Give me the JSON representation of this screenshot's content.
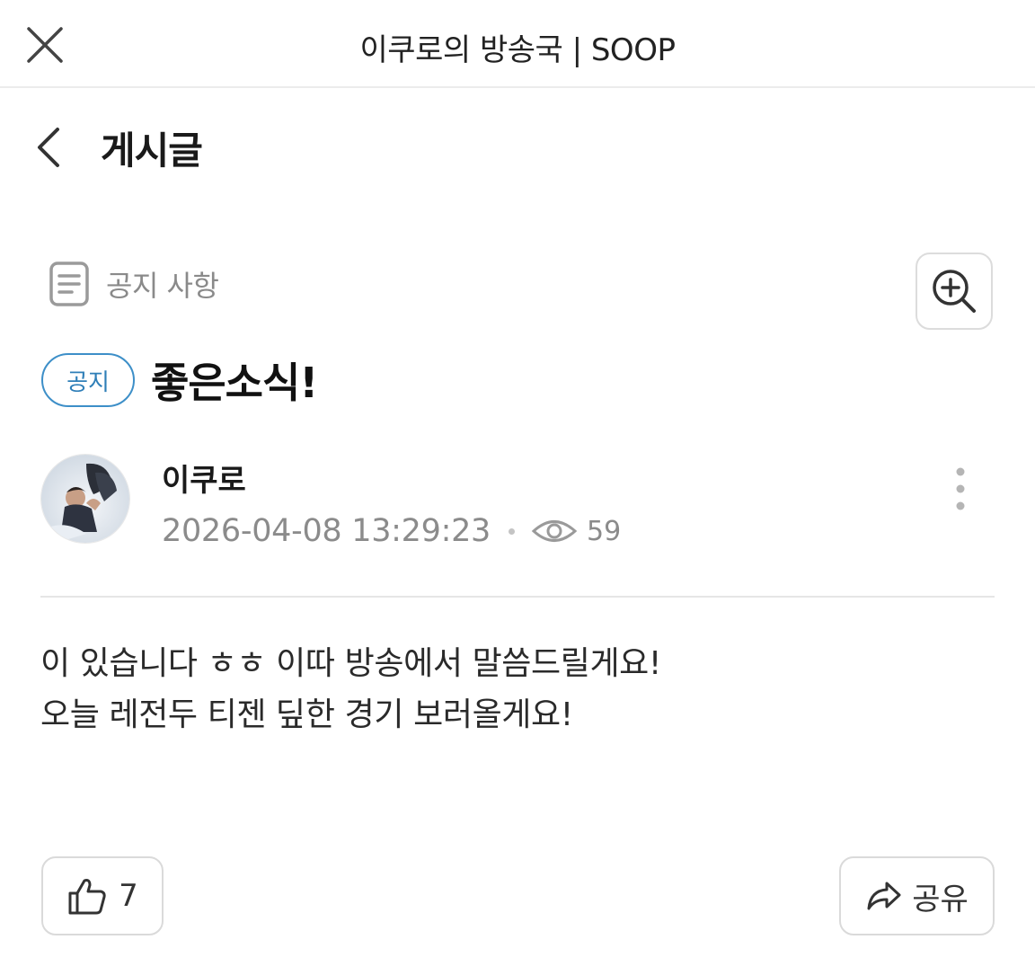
{
  "window": {
    "title": "이쿠로의 방송국 | SOOP"
  },
  "header": {
    "title": "게시글"
  },
  "post": {
    "category": "공지 사항",
    "badge": "공지",
    "title": "좋은소식!",
    "author": "이쿠로",
    "datetime": "2026-04-08 13:29:23",
    "views": "59",
    "body_lines": [
      "이 있습니다 ㅎㅎ 이따 방송에서 말씀드릴게요!",
      "오늘 레전두 티젠 딮한 경기 보러올게요!"
    ]
  },
  "actions": {
    "like_count": "7",
    "share_label": "공유"
  },
  "colors": {
    "badge_accent": "#3d8fc8",
    "muted_text": "#8b8b8b",
    "border": "#dadada"
  },
  "icons": [
    "close-icon",
    "back-chevron-icon",
    "document-icon",
    "zoom-in-icon",
    "eye-icon",
    "more-vertical-icon",
    "thumbs-up-icon",
    "share-arrow-icon"
  ]
}
